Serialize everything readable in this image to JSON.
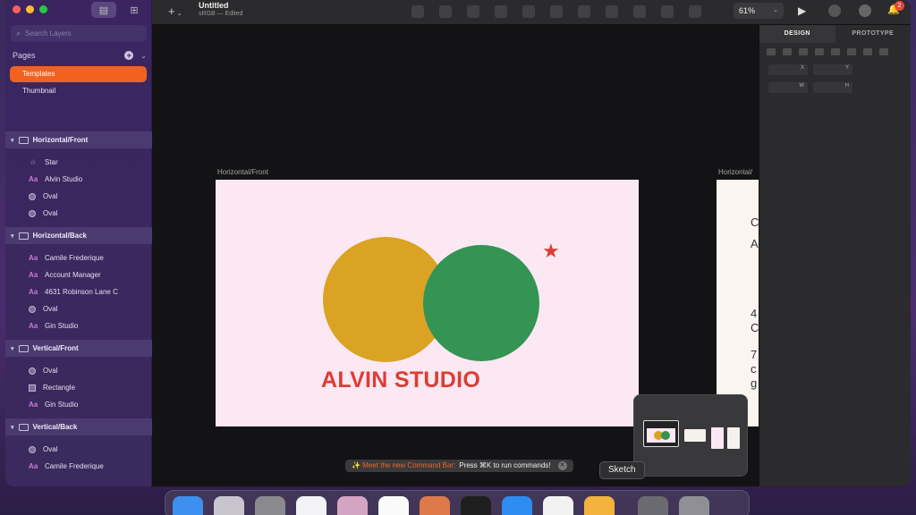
{
  "sidebar": {
    "search_placeholder": "Search Layers",
    "pages_label": "Pages",
    "pages": [
      {
        "label": "Templates",
        "selected": true
      },
      {
        "label": "Thumbnail",
        "selected": false
      }
    ],
    "groups": [
      {
        "name": "Horizontal/Front",
        "layers": [
          {
            "icon": "star-icon",
            "glyph": "☆",
            "label": "Star"
          },
          {
            "icon": "text-icon",
            "glyph": "Aa",
            "label": "Alvin Studio"
          },
          {
            "icon": "oval-icon",
            "glyph": "",
            "label": "Oval"
          },
          {
            "icon": "oval-icon",
            "glyph": "",
            "label": "Oval"
          }
        ]
      },
      {
        "name": "Horizontal/Back",
        "layers": [
          {
            "icon": "text-icon",
            "glyph": "Aa",
            "label": "Camile Frederique"
          },
          {
            "icon": "text-icon",
            "glyph": "Aa",
            "label": "Account Manager"
          },
          {
            "icon": "text-icon",
            "glyph": "Aa",
            "label": "4631 Robinson Lane C"
          },
          {
            "icon": "oval-icon",
            "glyph": "",
            "label": "Oval"
          },
          {
            "icon": "text-icon",
            "glyph": "Aa",
            "label": "Gin Studio"
          }
        ]
      },
      {
        "name": "Vertical/Front",
        "layers": [
          {
            "icon": "oval-icon",
            "glyph": "",
            "label": "Oval"
          },
          {
            "icon": "rectangle-icon",
            "glyph": "",
            "label": "Rectangle"
          },
          {
            "icon": "text-icon",
            "glyph": "Aa",
            "label": "Gin Studio"
          }
        ]
      },
      {
        "name": "Vertical/Back",
        "layers": [
          {
            "icon": "oval-icon",
            "glyph": "",
            "label": "Oval"
          },
          {
            "icon": "text-icon",
            "glyph": "Aa",
            "label": "Camile Frederique"
          }
        ]
      }
    ]
  },
  "toolbar": {
    "doc_title": "Untitled",
    "doc_subtitle": "sRGB — Edited",
    "zoom": "61%",
    "notification_count": "2"
  },
  "inspector": {
    "tabs": [
      "DESIGN",
      "PROTOTYPE"
    ],
    "field_labels": [
      "X",
      "Y",
      "W",
      "H"
    ]
  },
  "canvas": {
    "artboard1_label": "Horizontal/Front",
    "artboard1_title": "ALVIN STUDIO",
    "artboard2_label": "Horizontal/",
    "artboard2_lines": [
      "C",
      "A",
      "4",
      "C",
      "7",
      "c",
      "g"
    ],
    "command_bar": {
      "highlight": "✨ Meet the new Command Bar:",
      "text": "Press ⌘K to run commands!"
    },
    "tooltip": "Sketch"
  },
  "colors": {
    "accent": "#f2621e",
    "yellow_circle": "#dba324",
    "green_circle": "#349454",
    "red": "#dc3d34",
    "artboard_bg": "#fce8f3"
  }
}
